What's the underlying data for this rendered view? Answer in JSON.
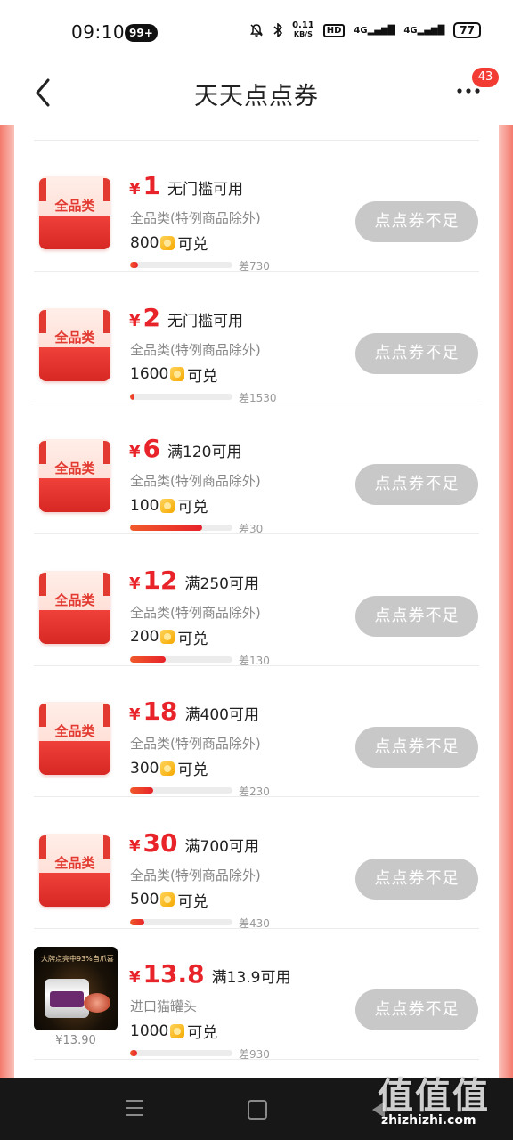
{
  "status_bar": {
    "time": "09:10",
    "notif_badge": "99+",
    "net_speed_value": "0.11",
    "net_speed_unit": "KB/S",
    "hd_label": "HD",
    "signal1": "4G",
    "signal2": "4G",
    "battery": "77"
  },
  "header": {
    "title": "天天点点券",
    "notification_count": "43"
  },
  "items": [
    {
      "icon_label": "全品类",
      "currency": "¥",
      "amount": "1",
      "condition": "无门槛可用",
      "scope": "全品类(特例商品除外)",
      "cost": "800",
      "cost_suffix": "可兑",
      "progress": 0.08,
      "diff": "差730",
      "action": "点点券不足"
    },
    {
      "icon_label": "全品类",
      "currency": "¥",
      "amount": "2",
      "condition": "无门槛可用",
      "scope": "全品类(特例商品除外)",
      "cost": "1600",
      "cost_suffix": "可兑",
      "progress": 0.04,
      "diff": "差1530",
      "action": "点点券不足"
    },
    {
      "icon_label": "全品类",
      "currency": "¥",
      "amount": "6",
      "condition": "满120可用",
      "scope": "全品类(特例商品除外)",
      "cost": "100",
      "cost_suffix": "可兑",
      "progress": 0.7,
      "diff": "差30",
      "action": "点点券不足"
    },
    {
      "icon_label": "全品类",
      "currency": "¥",
      "amount": "12",
      "condition": "满250可用",
      "scope": "全品类(特例商品除外)",
      "cost": "200",
      "cost_suffix": "可兑",
      "progress": 0.35,
      "diff": "差130",
      "action": "点点券不足"
    },
    {
      "icon_label": "全品类",
      "currency": "¥",
      "amount": "18",
      "condition": "满400可用",
      "scope": "全品类(特例商品除外)",
      "cost": "300",
      "cost_suffix": "可兑",
      "progress": 0.23,
      "diff": "差230",
      "action": "点点券不足"
    },
    {
      "icon_label": "全品类",
      "currency": "¥",
      "amount": "30",
      "condition": "满700可用",
      "scope": "全品类(特例商品除外)",
      "cost": "500",
      "cost_suffix": "可兑",
      "progress": 0.14,
      "diff": "差430",
      "action": "点点券不足"
    },
    {
      "product": true,
      "product_banner": "大牌点亮中93%自爪喜",
      "product_price": "¥13.90",
      "currency": "¥",
      "amount": "13.8",
      "condition": "满13.9可用",
      "scope": "进口猫罐头",
      "cost": "1000",
      "cost_suffix": "可兑",
      "progress": 0.07,
      "diff": "差930",
      "action": "点点券不足"
    }
  ],
  "watermark": {
    "big": "值值值",
    "small": "zhizhizhi.com"
  },
  "colors": {
    "accent_red": "#e8232a",
    "button_disabled": "#c8c8c8",
    "badge_red": "#f23b32"
  }
}
